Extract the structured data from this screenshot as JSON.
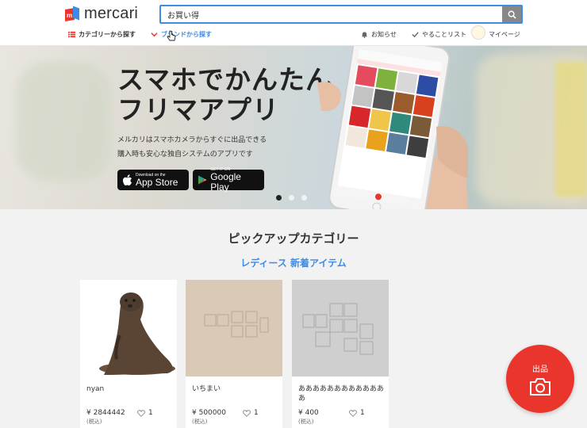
{
  "header": {
    "logo_text": "mercari",
    "search": {
      "value": "お買い得",
      "placeholder": ""
    },
    "nav": {
      "category": "カテゴリーから探す",
      "brand": "ブランドから探す",
      "notice": "お知らせ",
      "todo": "やることリスト",
      "mypage": "マイページ"
    }
  },
  "hero": {
    "title_line1": "スマホでかんたん",
    "title_line2": "フリマアプリ",
    "desc_line1": "メルカリはスマホカメラからすぐに出品できる",
    "desc_line2": "購入時も安心な独自システムのアプリです",
    "appstore_small": "Download on the",
    "appstore_big": "App Store",
    "gplay_small": "GET IT ON",
    "gplay_big": "Google Play",
    "slides": {
      "total": 3,
      "active": 1
    }
  },
  "pickup": {
    "title": "ピックアップカテゴリー",
    "subtitle": "レディース 新着アイテム",
    "items": [
      {
        "name": "nyan",
        "price": "¥ 2844442",
        "tax": "(税込)",
        "likes": "1"
      },
      {
        "name": "いちまい",
        "price": "¥ 500000",
        "tax": "(税込)",
        "likes": "1"
      },
      {
        "name": "あああああああああああああ",
        "price": "¥ 400",
        "tax": "(税込)",
        "likes": "1"
      }
    ]
  },
  "sell": {
    "label": "出品"
  },
  "colors": {
    "brand_red": "#ea352d",
    "accent_blue": "#3c8ce7"
  }
}
